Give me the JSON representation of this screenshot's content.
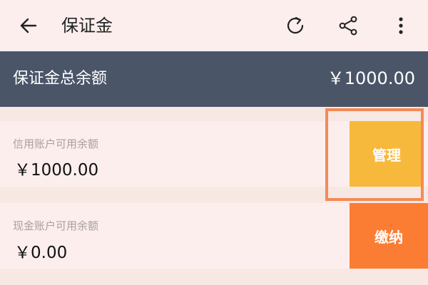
{
  "header": {
    "title": "保证金",
    "back_icon": "arrow-left-icon",
    "refresh_icon": "refresh-icon",
    "share_icon": "share-icon",
    "more_icon": "more-vertical-icon"
  },
  "summary": {
    "label": "保证金总余额",
    "amount": "￥1000.00"
  },
  "accounts": [
    {
      "caption": "信用账户可用余额",
      "amount": "￥1000.00",
      "action": "管理"
    },
    {
      "caption": "现金账户可用余额",
      "amount": "￥0.00",
      "action": "缴纳"
    }
  ],
  "colors": {
    "banner": "#4a5568",
    "manage_button": "#f7b93b",
    "pay_button": "#fb7c33",
    "highlight": "#f58a55"
  }
}
